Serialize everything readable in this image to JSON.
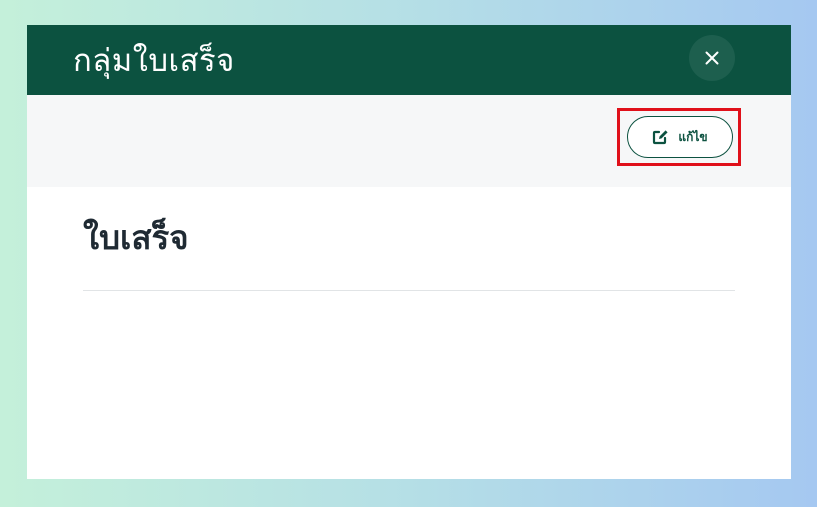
{
  "modal": {
    "title": "กลุ่มใบเสร็จ",
    "close_icon": "close-icon"
  },
  "toolbar": {
    "edit_label": "แก้ไข",
    "edit_icon": "edit-icon"
  },
  "content": {
    "section_title": "ใบเสร็จ"
  },
  "colors": {
    "header_bg": "#0c5240",
    "accent": "#0c5240",
    "highlight": "#e0101a",
    "toolbar_bg": "#f6f7f8"
  }
}
